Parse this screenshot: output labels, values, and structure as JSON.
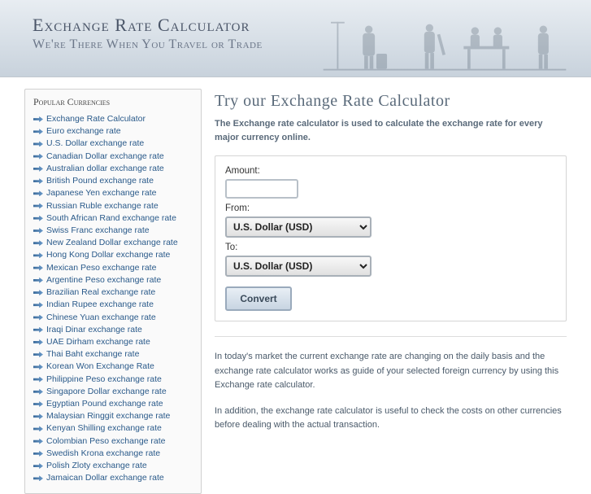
{
  "header": {
    "title": "Exchange Rate Calculator",
    "subtitle": "We're There When You Travel or Trade"
  },
  "sidebar": {
    "title": "Popular Currencies",
    "items": [
      "Exchange Rate Calculator",
      "Euro exchange rate",
      "U.S. Dollar exchange rate",
      "Canadian Dollar exchange rate",
      "Australian dollar exchange rate",
      "British Pound exchange rate",
      "Japanese Yen exchange rate",
      "Russian Ruble exchange rate",
      "South African Rand exchange rate",
      "Swiss Franc exchange rate",
      "New Zealand Dollar exchange rate",
      "Hong Kong Dollar exchange rate",
      "Mexican Peso exchange rate",
      "Argentine Peso exchange rate",
      "Brazilian Real exchange rate",
      "Indian Rupee exchange rate",
      "Chinese Yuan exchange rate",
      "Iraqi Dinar exchange rate",
      "UAE Dirham exchange rate",
      "Thai Baht exchange rate",
      "Korean Won Exchange Rate",
      "Philippine Peso exchange rate",
      "Singapore Dollar exchange rate",
      "Egyptian Pound exchange rate",
      "Malaysian Ringgit exchange rate",
      "Kenyan Shilling exchange rate",
      "Colombian Peso exchange rate",
      "Swedish Krona exchange rate",
      "Polish Zloty exchange rate",
      "Jamaican Dollar exchange rate"
    ]
  },
  "main": {
    "heading": "Try our Exchange Rate Calculator",
    "intro": "The Exchange rate calculator is used to calculate the exchange rate for every major currency online.",
    "form": {
      "amount_label": "Amount:",
      "amount_value": "",
      "from_label": "From:",
      "from_selected": "U.S. Dollar (USD)",
      "to_label": "To:",
      "to_selected": "U.S. Dollar (USD)",
      "convert_label": "Convert"
    },
    "para1": "In today's market the current exchange rate are changing on the daily basis and the exchange rate calculator works as guide of your selected foreign currency by using this Exchange rate calculator.",
    "para2": "In addition, the exchange rate calculator is useful to check the costs on other currencies before dealing with the actual transaction."
  }
}
